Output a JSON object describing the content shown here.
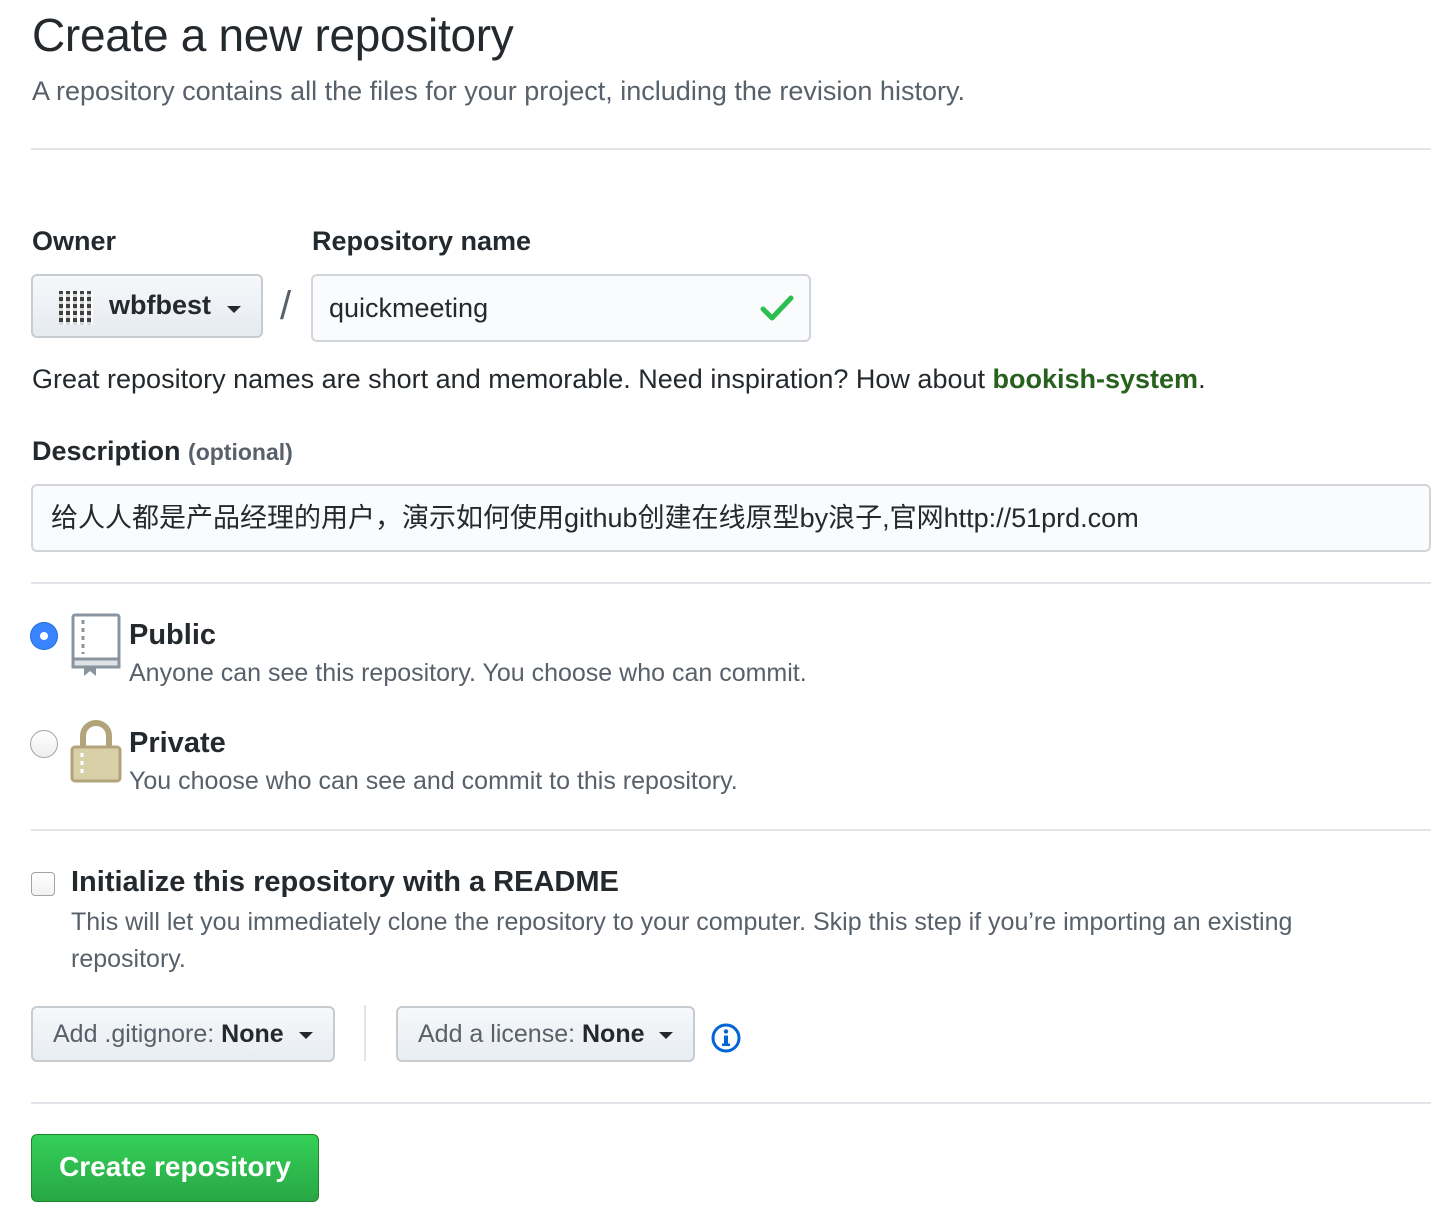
{
  "page": {
    "title": "Create a new repository",
    "subtitle": "A repository contains all the files for your project, including the revision history."
  },
  "owner": {
    "label": "Owner",
    "value": "wbfbest"
  },
  "repo": {
    "label": "Repository name",
    "separator": "/",
    "value": "quickmeeting",
    "valid": true
  },
  "hint": {
    "text": "Great repository names are short and memorable. Need inspiration? How about ",
    "suggestion": "bookish-system",
    "end": "."
  },
  "description": {
    "label": "Description",
    "optional_label": "(optional)",
    "value": "给人人都是产品经理的用户，演示如何使用github创建在线原型by浪子,官网http://51prd.com"
  },
  "visibility": {
    "selected": "public",
    "public": {
      "title": "Public",
      "desc": "Anyone can see this repository. You choose who can commit.",
      "icon": "repo-book-icon"
    },
    "private": {
      "title": "Private",
      "desc": "You choose who can see and commit to this repository.",
      "icon": "lock-icon"
    }
  },
  "readme": {
    "checked": false,
    "title": "Initialize this repository with a README",
    "desc": "This will let you immediately clone the repository to your computer. Skip this step if you’re importing an existing repository."
  },
  "gitignore": {
    "prefix": "Add .gitignore: ",
    "value": "None"
  },
  "license": {
    "prefix": "Add a license: ",
    "value": "None"
  },
  "info_icon": "info-icon",
  "submit": {
    "label": "Create repository"
  },
  "colors": {
    "accent_blue": "#3a84ff",
    "success_green": "#28a745",
    "suggestion_green": "#28601d",
    "check_green": "#2cbe4e"
  }
}
